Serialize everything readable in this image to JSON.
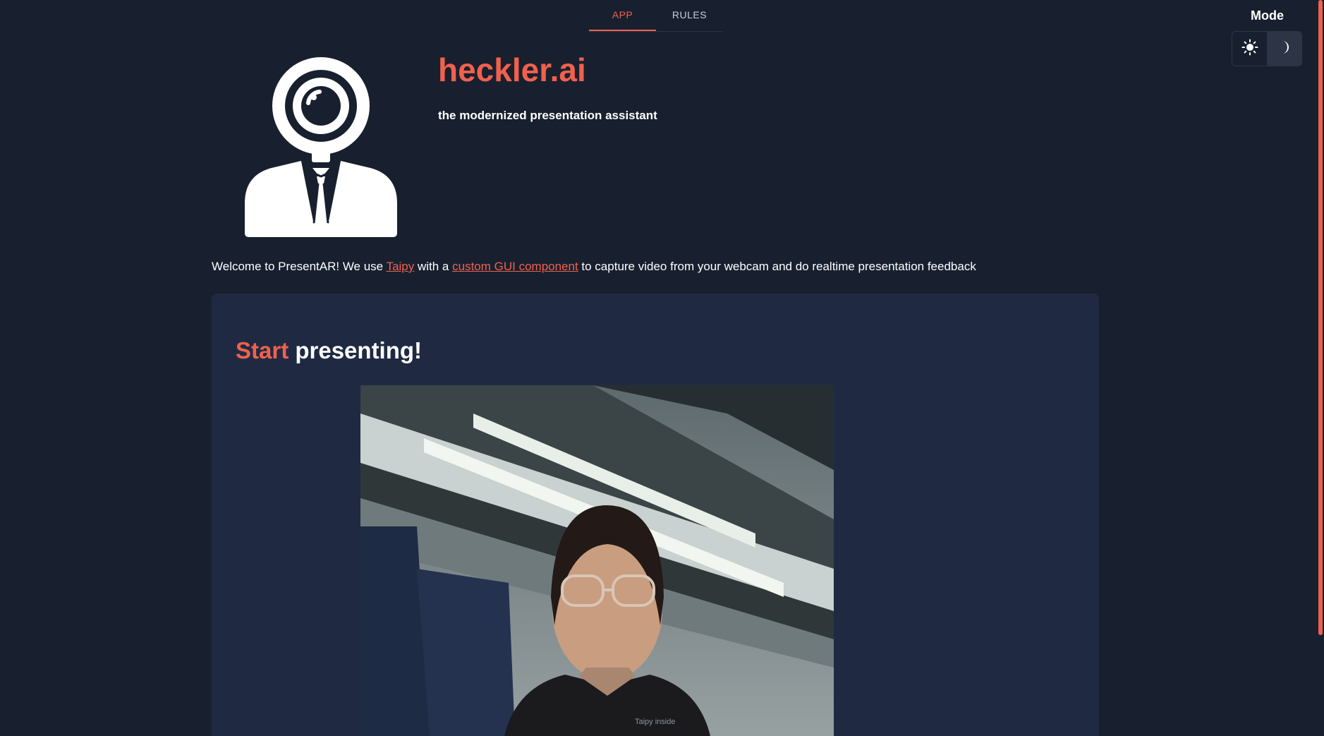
{
  "tabs": [
    {
      "label": "APP",
      "active": true
    },
    {
      "label": "RULES",
      "active": false
    }
  ],
  "mode": {
    "label": "Mode",
    "options": [
      "light",
      "dark"
    ],
    "selected": "dark",
    "light_icon": "sun-icon",
    "dark_icon": "moon-icon"
  },
  "header": {
    "title": "heckler.ai",
    "subtitle": "the modernized presentation assistant",
    "logo_icon": "presenter-magnifier-logo"
  },
  "welcome": {
    "prefix": "Welcome to PresentAR! We use ",
    "link1": "Taipy",
    "middle": " with a ",
    "link2": "custom GUI component",
    "suffix": " to capture video from your webcam and do realtime presentation feedback"
  },
  "presenting": {
    "accent": "Start",
    "rest": " presenting!"
  },
  "footer_note": "Taipy inside",
  "colors": {
    "accent": "#f0614d",
    "background": "#18202f",
    "card": "#1f2a42"
  }
}
